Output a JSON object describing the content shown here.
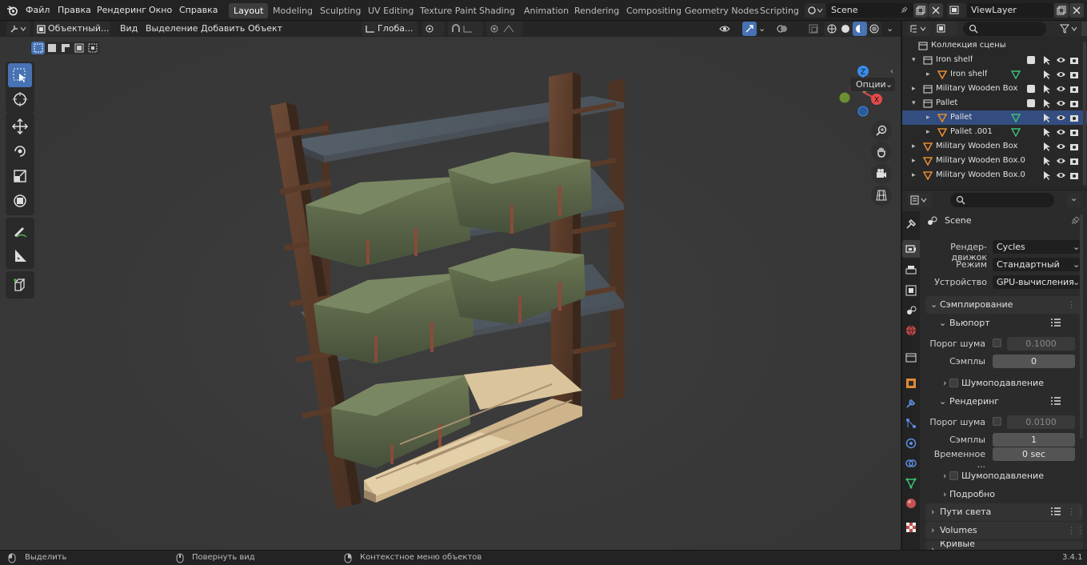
{
  "topbar": {
    "menus": [
      "Файл",
      "Правка",
      "Рендеринг",
      "Окно",
      "Справка"
    ],
    "workspaces": [
      "Layout",
      "Modeling",
      "Sculpting",
      "UV Editing",
      "Texture Paint",
      "Shading",
      "Animation",
      "Rendering",
      "Compositing",
      "Geometry Nodes",
      "Scripting"
    ],
    "active_workspace": "Layout",
    "scene": "Scene",
    "view_layer": "ViewLayer"
  },
  "viewport_header": {
    "mode": "Объектный...",
    "menus": [
      "Вид",
      "Выделение",
      "Добавить",
      "Объект"
    ],
    "orientation": "Глоба...",
    "options": "Опции"
  },
  "outliner": {
    "rows": [
      {
        "label": "Коллекция сцены",
        "kind": "scene-collection"
      },
      {
        "label": "Iron shelf",
        "kind": "collection",
        "expanded": true
      },
      {
        "label": "Iron shelf",
        "kind": "mesh",
        "child": true
      },
      {
        "label": "Military Wooden Box",
        "kind": "collection"
      },
      {
        "label": "Pallet",
        "kind": "collection",
        "expanded": true
      },
      {
        "label": "Pallet",
        "kind": "mesh",
        "child": true,
        "selected": true
      },
      {
        "label": "Pallet .001",
        "kind": "mesh",
        "child": true
      },
      {
        "label": "Military Wooden Box",
        "kind": "mesh"
      },
      {
        "label": "Military Wooden Box.0",
        "kind": "mesh"
      },
      {
        "label": "Military Wooden Box.0",
        "kind": "mesh"
      }
    ]
  },
  "properties": {
    "title": "Scene",
    "render_engine_label": "Рендер-движок",
    "render_engine": "Cycles",
    "mode_label": "Режим",
    "mode": "Стандартный",
    "device_label": "Устройство",
    "device": "GPU-вычисления",
    "sampling": "Сэмплирование",
    "viewport": "Вьюпорт",
    "noise_threshold_label": "Порог шума",
    "viewport_noise_threshold": "0.1000",
    "samples_label": "Сэмплы",
    "viewport_samples": "0",
    "denoise": "Шумоподавление",
    "render": "Рендеринг",
    "render_noise_threshold": "0.0100",
    "render_samples": "1",
    "time_limit_label": "Временное ...",
    "time_limit": "0 sec",
    "advanced": "Подробно",
    "light_paths": "Пути света",
    "volumes": "Volumes",
    "curves": "Кривые"
  },
  "statusbar": {
    "select": "Выделить",
    "rotate": "Повернуть вид",
    "context": "Контекстное меню объектов",
    "version": "3.4.1"
  },
  "colors": {
    "accent": "#4772b3",
    "header": "#232323",
    "viewport": "#393939",
    "panel": "#2b2b2b"
  }
}
